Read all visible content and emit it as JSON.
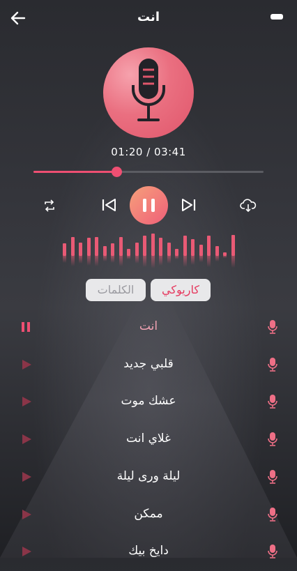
{
  "header": {
    "title": "انت"
  },
  "player": {
    "time": "01:20 / 03:41",
    "progress": 0.36
  },
  "eq_levels": [
    0.55,
    0.85,
    0.6,
    0.8,
    0.85,
    0.45,
    0.55,
    0.85,
    0.3,
    0.6,
    0.9,
    1.0,
    0.8,
    0.6,
    0.3,
    0.9,
    0.75,
    0.5,
    0.9,
    0.45,
    0.15,
    0.95
  ],
  "tabs": {
    "karaoke": "كاريوكي",
    "lyrics": "الكلمات"
  },
  "songs": [
    {
      "title": "انت",
      "state": "playing"
    },
    {
      "title": "قلبي جديد",
      "state": "idle"
    },
    {
      "title": "عشك موت",
      "state": "idle"
    },
    {
      "title": "غلاي انت",
      "state": "idle"
    },
    {
      "title": "ليلة ورى ليلة",
      "state": "idle"
    },
    {
      "title": "ممكن",
      "state": "idle"
    },
    {
      "title": "دايخ بيك",
      "state": "idle"
    }
  ],
  "colors": {
    "accent": "#ee4f72",
    "disc": "#e0566b",
    "play_start": "#f6a07a"
  }
}
